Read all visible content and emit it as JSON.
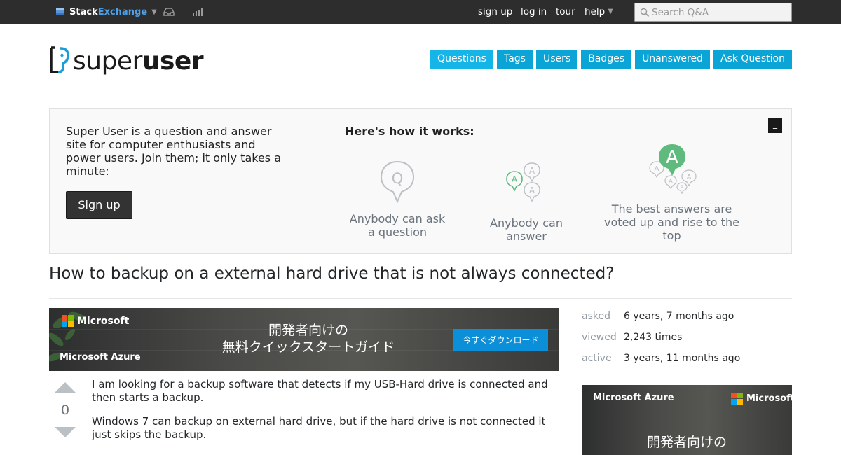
{
  "topbar": {
    "brand_stack": "Stack",
    "brand_exchange": "Exchange",
    "links": [
      "sign up",
      "log in",
      "tour",
      "help"
    ],
    "search_placeholder": "Search Q&A",
    "icons": [
      "stackexchange-icon",
      "inbox-icon",
      "achievements-icon",
      "search-icon"
    ]
  },
  "header": {
    "logo_light": "super",
    "logo_bold": "user",
    "nav": [
      "Questions",
      "Tags",
      "Users",
      "Badges",
      "Unanswered",
      "Ask Question"
    ]
  },
  "hero": {
    "intro": "Super User is a question and answer site for computer enthusiasts and power users. Join them; it only takes a minute:",
    "signup_label": "Sign up",
    "how_title": "Here's how it works:",
    "close_label": "_",
    "steps": [
      {
        "text": "Anybody can ask a question",
        "icon": "question-bubble-icon"
      },
      {
        "text": "Anybody can answer",
        "icon": "answer-bubbles-icon"
      },
      {
        "text": "The best answers are voted up and rise to the top",
        "icon": "best-answer-icon"
      }
    ],
    "step_icon_letters": {
      "question": "Q",
      "answer": "A"
    }
  },
  "question": {
    "title": "How to backup on a external hard drive that is not always connected?",
    "votes": "0",
    "body": [
      "I am looking for a backup software that detects if my USB-Hard drive is connected and then starts a backup.",
      "Windows 7 can backup on external hard drive, but if the hard drive is not connected it just skips the backup."
    ]
  },
  "ad_main": {
    "brand": "Microsoft",
    "product": "Microsoft Azure",
    "headline_line1": "開発者向けの",
    "headline_line2": "無料クイックスタートガイド",
    "cta": "今すぐダウンロード"
  },
  "ad_side": {
    "brand": "Microsoft",
    "product": "Microsoft Azure",
    "headline_line1": "開発者向けの"
  },
  "stats": [
    {
      "label": "asked",
      "value": "6 years, 7 months ago"
    },
    {
      "label": "viewed",
      "value": "2,243 times"
    },
    {
      "label": "active",
      "value": "3 years, 11 months ago"
    }
  ],
  "colors": {
    "topbar_bg": "#2d2d2d",
    "nav_tab": "#0aa4d6",
    "brand_blue": "#4ca0e7",
    "answer_green": "#5eba7d",
    "ms_red": "#f25022",
    "ms_green": "#7fba00",
    "ms_blue": "#00a4ef",
    "ms_yellow": "#ffb900"
  }
}
